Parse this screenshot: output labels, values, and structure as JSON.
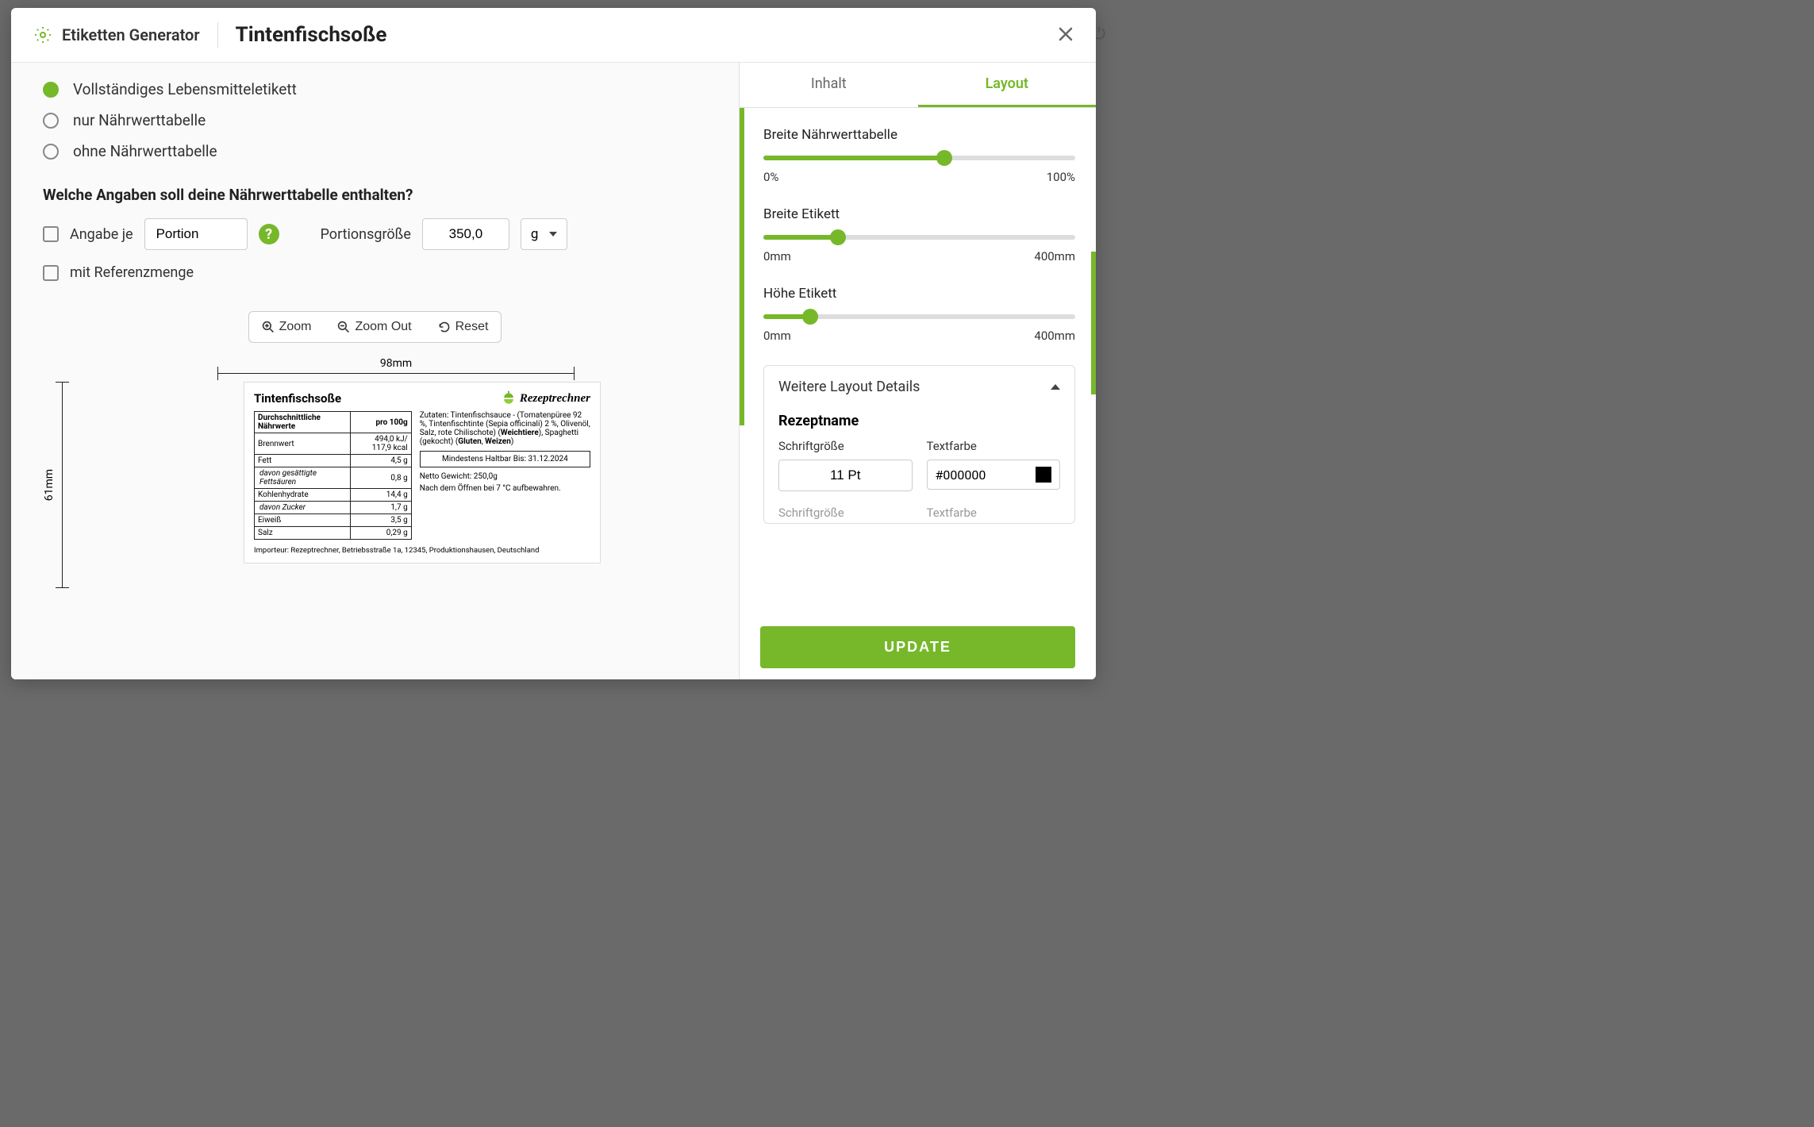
{
  "header": {
    "app_title": "Etiketten Generator",
    "recipe_name": "Tintenfischsoße"
  },
  "left": {
    "radios": [
      {
        "label": "Vollständiges Lebensmitteletikett",
        "selected": true
      },
      {
        "label": "nur Nährwerttabelle",
        "selected": false
      },
      {
        "label": "ohne Nährwerttabelle",
        "selected": false
      }
    ],
    "section_heading": "Welche Angaben soll deine Nährwerttabelle enthalten?",
    "angabe_je_label": "Angabe je",
    "angabe_je_value": "Portion",
    "portion_label": "Portionsgröße",
    "portion_value": "350,0",
    "unit_value": "g",
    "referenzmenge_label": "mit Referenzmenge",
    "zoom": {
      "in": "Zoom",
      "out": "Zoom Out",
      "reset": "Reset"
    },
    "preview": {
      "width_label": "98mm",
      "height_label": "61mm",
      "title": "Tintenfischsoße",
      "logo_text": "Rezeptrechner",
      "table_header_left": "Durchschnittliche Nährwerte",
      "table_header_right": "pro 100g",
      "rows": [
        {
          "name": "Brennwert",
          "value": "494,0 kJ/ 117,9 kcal"
        },
        {
          "name": "Fett",
          "value": "4,5 g"
        },
        {
          "name": "davon gesättigte Fettsäuren",
          "value": "0,8 g",
          "sub": true
        },
        {
          "name": "Kohlenhydrate",
          "value": "14,4 g"
        },
        {
          "name": "davon Zucker",
          "value": "1,7 g",
          "sub": true
        },
        {
          "name": "Eiweiß",
          "value": "3,5 g"
        },
        {
          "name": "Salz",
          "value": "0,29 g"
        }
      ],
      "ingredients_prefix": "Zutaten: Tintenfischsauce - (Tomatenpüree 92 %, Tintenfischtinte (Sepia officinali) 2 %, Olivenöl, Salz, rote Chilischote) (",
      "allergen1": "Weichtiere",
      "ingredients_mid": "), Spaghetti (gekocht) (",
      "allergen2": "Gluten",
      "comma": ", ",
      "allergen3": "Weizen",
      "ingredients_suffix": ")",
      "best_before": "Mindestens Haltbar Bis: 31.12.2024",
      "net_weight": "Netto Gewicht: 250,0g",
      "storage": "Nach dem Öffnen bei 7 °C aufbewahren.",
      "importer": "Importeur: Rezeptrechner, Betriebsstraße 1a, 12345, Produktionshausen, Deutschland"
    }
  },
  "right": {
    "tabs": {
      "content": "Inhalt",
      "layout": "Layout"
    },
    "sliders": [
      {
        "title": "Breite Nährwerttabelle",
        "min": "0%",
        "max": "100%",
        "percent": 58
      },
      {
        "title": "Breite Etikett",
        "min": "0mm",
        "max": "400mm",
        "percent": 24
      },
      {
        "title": "Höhe Etikett",
        "min": "0mm",
        "max": "400mm",
        "percent": 15
      }
    ],
    "accordion": {
      "title": "Weitere Layout Details",
      "subtitle": "Rezeptname",
      "fontsize_label": "Schriftgröße",
      "fontsize_value": "11 Pt",
      "color_label": "Textfarbe",
      "color_value": "#000000"
    },
    "cutoff": {
      "left": "Schriftgröße",
      "right": "Textfarbe"
    },
    "update_label": "UPDATE"
  }
}
